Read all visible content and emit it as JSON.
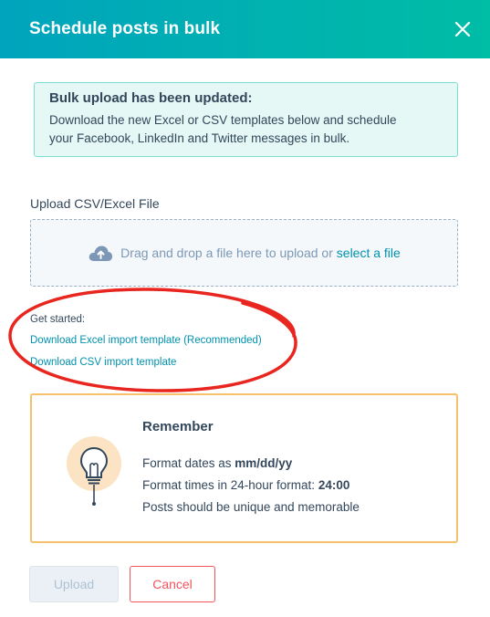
{
  "header": {
    "title": "Schedule posts in bulk",
    "close_icon": "close-icon"
  },
  "alert": {
    "title": "Bulk upload has been updated:",
    "line1": "Download the new Excel or CSV templates below and schedule",
    "line2": "your Facebook, LinkedIn and Twitter messages in bulk."
  },
  "upload": {
    "label": "Upload CSV/Excel File",
    "drop_text": "Drag and drop a file here to upload or ",
    "select_link": "select a file",
    "icon": "cloud-upload-icon"
  },
  "templates": {
    "get_started": "Get started:",
    "excel_link": "Download Excel import template (Recommended)",
    "csv_link": "Download CSV import template"
  },
  "remember": {
    "title": "Remember",
    "icon": "lightbulb-icon",
    "dates_prefix": "Format dates as ",
    "dates_format": "mm/dd/yy",
    "times_prefix": "Format times in 24-hour format: ",
    "times_format": "24:00",
    "unique_line": "Posts should be unique and memorable"
  },
  "footer": {
    "upload_label": "Upload",
    "cancel_label": "Cancel"
  },
  "colors": {
    "header_gradient_start": "#00a4bd",
    "header_gradient_end": "#00bda5",
    "link": "#0091ae",
    "annotation_red": "#e8261f",
    "remember_border": "#f5c26b",
    "cancel_red": "#f2545b"
  }
}
